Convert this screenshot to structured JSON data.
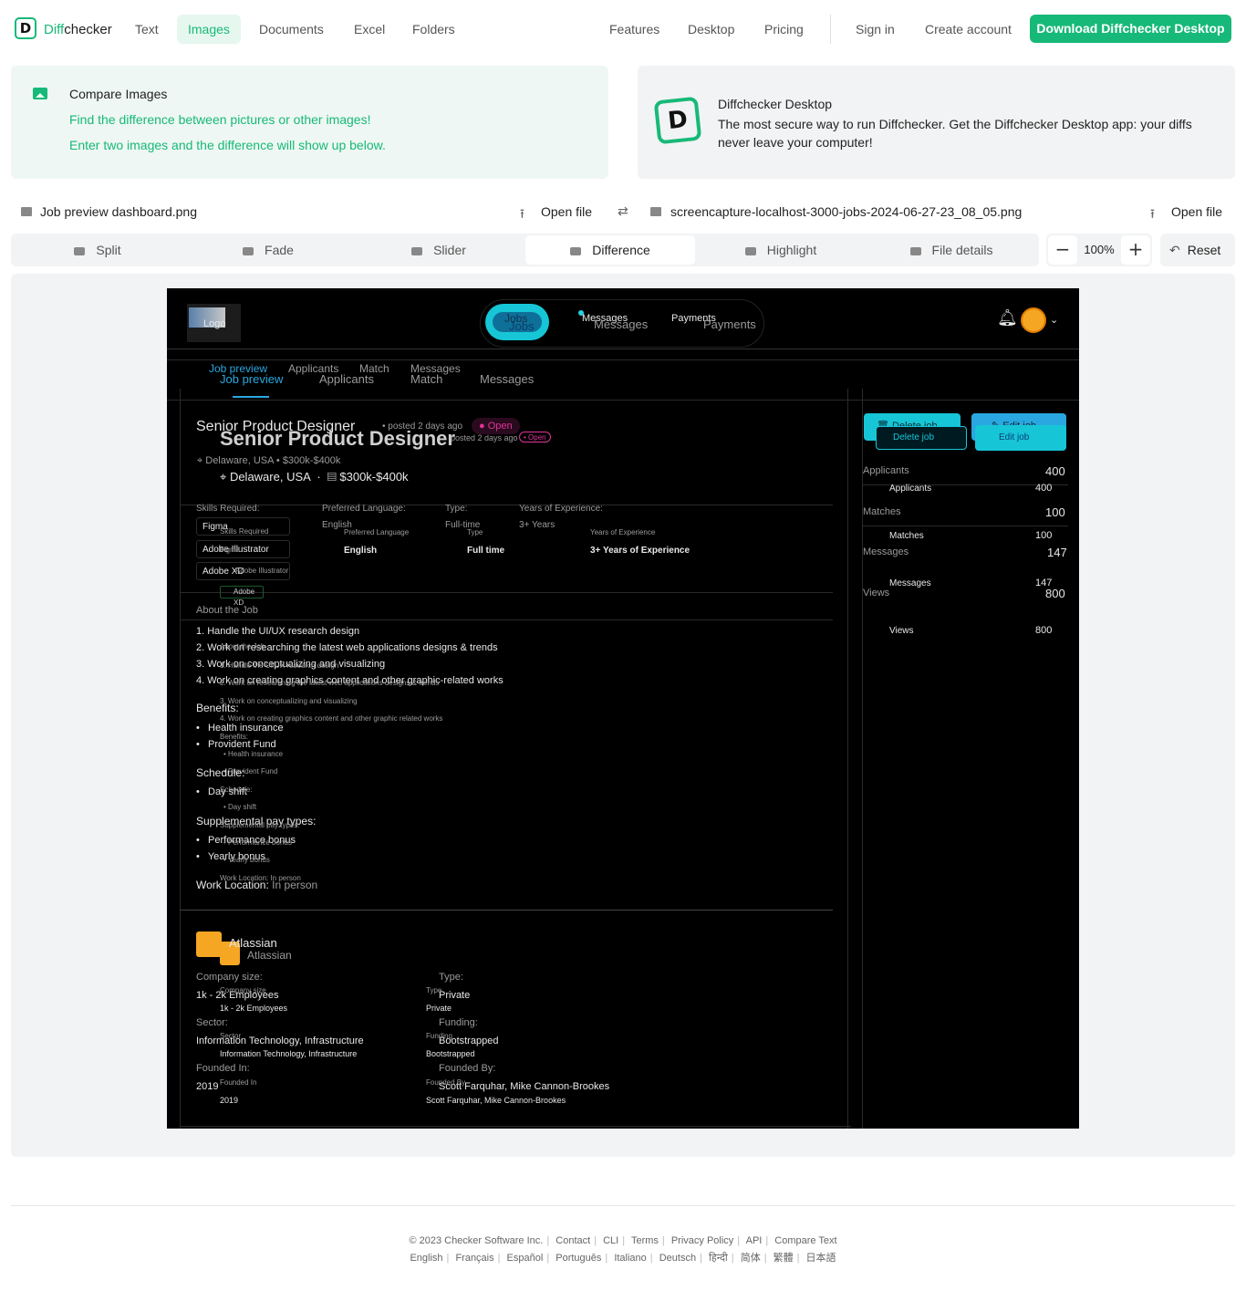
{
  "header": {
    "brand_prefix": "Diff",
    "brand_suffix": "checker",
    "logo_letter": "D",
    "nav": [
      "Text",
      "Images",
      "Documents",
      "Excel",
      "Folders"
    ],
    "nav_active": "Images",
    "right_nav": [
      "Features",
      "Desktop",
      "Pricing"
    ],
    "sign_in": "Sign in",
    "create_account": "Create account",
    "download": "Download Diffchecker Desktop"
  },
  "banner_compare": {
    "title": "Compare Images",
    "line1": "Find the difference between pictures or other images!",
    "line2": "Enter two images and the difference will show up below."
  },
  "banner_desktop": {
    "icon_letter": "D",
    "title": "Diffchecker Desktop",
    "desc": "The most secure way to run Diffchecker. Get the Diffchecker Desktop app: your diffs never leave your computer!"
  },
  "files": {
    "left": "Job preview dashboard.png",
    "right": "screencapture-localhost-3000-jobs-2024-06-27-23_08_05.png",
    "open": "Open file"
  },
  "modes": [
    "Split",
    "Fade",
    "Slider",
    "Difference",
    "Highlight",
    "File details"
  ],
  "mode_active": "Difference",
  "zoom": {
    "minus": "−",
    "value": "100%",
    "plus": "+"
  },
  "reset": "Reset",
  "diff": {
    "logo": "Logo",
    "top_tabs": {
      "jobs": "Jobs",
      "messages": "Messages",
      "payments": "Payments"
    },
    "sub_tabs_a": [
      "Job preview",
      "Applicants",
      "Match",
      "Messages"
    ],
    "sub_tabs_b": [
      "Job preview",
      "Applicants",
      "Match",
      "Messages"
    ],
    "title_a": "Senior Product Designer",
    "title_b": "Senior Product Designer",
    "posted_a": "posted 2 days ago",
    "posted_b": "posted 2 days ago",
    "status": "Open",
    "location_a": "Delaware, USA",
    "salary_a": "$300k-$400k",
    "location_b": "Delaware, USA",
    "salary_b": "$300k-$400k",
    "skills_label": "Skills Required:",
    "skills_label_b": "Skills Required",
    "skills": [
      "Figma",
      "Adobe Illustrator",
      "Adobe XD"
    ],
    "skills_b": [
      "Figma",
      "Adobe Illustrator",
      "Adobe XD"
    ],
    "pref_lang_label": "Preferred Language:",
    "pref_lang": "English",
    "pref_lang_label_b": "Preferred Language",
    "pref_lang_b": "English",
    "type_label": "Type:",
    "type": "Full-time",
    "type_label_b": "Type",
    "type_b": "Full time",
    "exp_label": "Years of Experience:",
    "exp": "3+ Years",
    "exp_label_b": "Years of Experience",
    "exp_b": "3+ Years of Experience",
    "about_label": "About the Job",
    "about_label_b": "About the Job",
    "about_items": [
      "1. Handle the UI/UX research design",
      "2. Work on researching the latest web applications designs & trends",
      "3. Work on conceptualizing and visualizing",
      "4. Work on creating graphics content and other graphic-related works"
    ],
    "about_items_b": [
      "1. Handle the UI/UX research design",
      "2. Work on researching the latest web applications designs & trends",
      "3. Work on conceptualizing and visualizing",
      "4. Work on creating graphics content and other graphic related works"
    ],
    "benefits_label": "Benefits:",
    "benefits": [
      "Health insurance",
      "Provident Fund"
    ],
    "benefits_label_b": "Benefits:",
    "benefits_b": [
      "Health insurance",
      "Provident Fund"
    ],
    "schedule_label": "Schedule:",
    "schedule": [
      "Day shift"
    ],
    "schedule_label_b": "Schedule:",
    "schedule_b": [
      "Day shift"
    ],
    "supp_label": "Supplemental pay types:",
    "supp": [
      "Performance bonus",
      "Yearly bonus"
    ],
    "supp_label_b": "Supplemental pay types:",
    "supp_b": [
      "Performance bonus",
      "Yearly bonus"
    ],
    "work_loc_label": "Work Location:",
    "work_loc": "In person",
    "work_loc_b": "Work Location: In person",
    "company": "Atlassian",
    "company_b": "Atlassian",
    "company_fields_a": [
      {
        "label": "Company size:",
        "value": "1k - 2k Employees"
      },
      {
        "label": "Type:",
        "value": "Private"
      },
      {
        "label": "Sector:",
        "value": "Information Technology, Infrastructure"
      },
      {
        "label": "Funding:",
        "value": "Bootstrapped"
      },
      {
        "label": "Founded In:",
        "value": "2019"
      },
      {
        "label": "Founded By:",
        "value": "Scott Farquhar, Mike Cannon-Brookes"
      }
    ],
    "company_fields_b": [
      {
        "label": "Company size",
        "value": "1k - 2k Employees"
      },
      {
        "label": "Type",
        "value": "Private"
      },
      {
        "label": "Sector",
        "value": "Information Technology, Infrastructure"
      },
      {
        "label": "Funding",
        "value": "Bootstrapped"
      },
      {
        "label": "Founded In",
        "value": "2019"
      },
      {
        "label": "Founded By",
        "value": "Scott Farquhar, Mike Cannon-Brookes"
      }
    ],
    "delete_job": "Delete job",
    "edit_job": "Edit job",
    "stats_a": [
      {
        "label": "Applicants",
        "value": "400"
      },
      {
        "label": "Matches",
        "value": "100"
      },
      {
        "label": "Messages",
        "value": "147"
      },
      {
        "label": "Views",
        "value": "800"
      }
    ],
    "stats_b": [
      {
        "label": "Applicants",
        "value": "400"
      },
      {
        "label": "Matches",
        "value": "100"
      },
      {
        "label": "Messages",
        "value": "147"
      },
      {
        "label": "Views",
        "value": "800"
      }
    ],
    "colors": {
      "accent": "#17b978",
      "cyan": "#16c6d6",
      "blue": "#2aa7e0",
      "orange": "#f5a623",
      "pink": "#e0349a"
    }
  },
  "footer": {
    "row1": [
      "© 2023 Checker Software Inc.",
      "Contact",
      "CLI",
      "Terms",
      "Privacy Policy",
      "API",
      "Compare Text"
    ],
    "row2": [
      "English",
      "Français",
      "Español",
      "Português",
      "Italiano",
      "Deutsch",
      "हिन्दी",
      "简体",
      "繁體",
      "日本語"
    ]
  }
}
